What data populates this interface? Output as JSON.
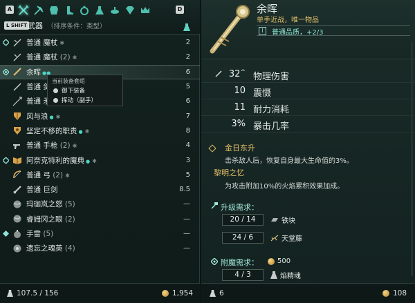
{
  "keys": {
    "left": "A",
    "right": "D",
    "shift": "L SHIFT"
  },
  "category": {
    "title": "武器",
    "sort": "（排序条件：类型）"
  },
  "list": [
    {
      "name": "普通 魔杖",
      "suffix": "",
      "value": "2"
    },
    {
      "name": "普通 魔杖",
      "suffix": "(2)",
      "value": "2"
    },
    {
      "name": "余晖",
      "suffix": "",
      "value": "6"
    },
    {
      "name": "普通 剑",
      "suffix": "",
      "value": "5"
    },
    {
      "name": "普通 矛",
      "suffix": "",
      "value": "6"
    },
    {
      "name": "风与浪",
      "suffix": "",
      "value": "7"
    },
    {
      "name": "坚定不移的职责",
      "suffix": "",
      "value": "8"
    },
    {
      "name": "普通 手枪",
      "suffix": "(2)",
      "value": "4"
    },
    {
      "name": "阿奈克特利的魔典",
      "suffix": "",
      "value": "3"
    },
    {
      "name": "普通 弓",
      "suffix": "(2)",
      "value": "5"
    },
    {
      "name": "普通 巨剑",
      "suffix": "",
      "value": "8.5"
    },
    {
      "name": "玛珈岚之怒",
      "suffix": "(5)",
      "value": "—"
    },
    {
      "name": "睿姆冈之眼",
      "suffix": "(2)",
      "value": "—"
    },
    {
      "name": "手雷",
      "suffix": "(5)",
      "value": "—"
    },
    {
      "name": "遗忘之魂英",
      "suffix": "(4)",
      "value": "—"
    }
  ],
  "context_menu": {
    "header": "当前装备套组",
    "items": [
      "御下装备",
      "挥动（副手）"
    ]
  },
  "left_footer": {
    "weight": "107.5 / 156",
    "gold": "1,954"
  },
  "item": {
    "name": "余晖",
    "type": "单手近战，唯一物品",
    "quality_level": "I",
    "quality": "普通品质，+2/3",
    "stats": [
      {
        "value": "32",
        "mark": "^",
        "label": "物理伤害"
      },
      {
        "value": "10",
        "mark": "",
        "label": "震慑"
      },
      {
        "value": "11",
        "mark": "",
        "label": "耐力消耗"
      },
      {
        "value": "3%",
        "mark": "",
        "label": "暴击几率"
      }
    ],
    "skill1": {
      "title": "金日东升",
      "desc": "击杀敌人后，恢复自身最大生命值的3%。"
    },
    "skill2": {
      "title": "黎明之忆",
      "desc": "为攻击附加10%的火焰累积效果加成。"
    },
    "upgrade": {
      "title": "升级需求：",
      "reqs": [
        {
          "count": "20 / 14",
          "material": "铁块"
        },
        {
          "count": "24 / 6",
          "material": "天堂藤"
        }
      ]
    },
    "enchant": {
      "title": "附魔需求：",
      "gold": "500",
      "count": "4 / 3",
      "material": "焰精魂"
    }
  },
  "right_footer": {
    "left": "6",
    "right": "108"
  },
  "colors": {
    "gold_text": "#e2be6a",
    "teal_text": "#8fe2d6",
    "panel_bg": "#14221f"
  }
}
